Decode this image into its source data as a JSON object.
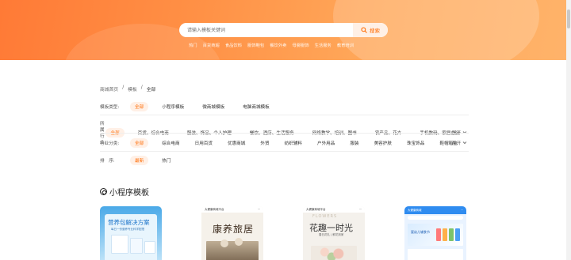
{
  "search": {
    "placeholder": "请输入模板关键词",
    "button_label": "搜索"
  },
  "hot_tags": [
    "热门",
    "百货商超",
    "食品饮料",
    "服饰鞋包",
    "餐饮外卖",
    "母婴服饰",
    "生活服务",
    "教育培训"
  ],
  "breadcrumb": {
    "home": "商城首页",
    "sep": "/",
    "templates": "模板",
    "current": "全部"
  },
  "filters": {
    "template_type": {
      "label": "模板类型:",
      "options": [
        "全部",
        "小程序模板",
        "微商城模板",
        "电脑商城模板"
      ],
      "selected": 0
    },
    "industry": {
      "label": "所属行业:",
      "options": [
        "全部",
        "百货、综合电商",
        "服装、饰品、个人护理",
        "餐饮、酒店、生活服务",
        "网络教学、培训、图书",
        "农产品、花卉",
        "手机数码、家居办公"
      ],
      "selected": 0,
      "expand": "展开"
    },
    "industry_class": {
      "label": "行业分类:",
      "options": [
        "全部",
        "综合电商",
        "日用百货",
        "优惠商城",
        "外贸",
        "纺织辅料",
        "户外用品",
        "服装",
        "美容护肤",
        "珠宝饰品",
        "鞋帽箱包"
      ],
      "selected": 0,
      "expand": "展开"
    },
    "sort": {
      "label": "排　序:",
      "options": [
        "最新",
        "热门"
      ],
      "selected": 0
    }
  },
  "section_title": "小程序模板",
  "cards": [
    {
      "title": "营养包解决方案",
      "subtitle": "每日一份营养专业科学配搭",
      "accent": "#ff6a00"
    },
    {
      "topbar": "大健康商城平台",
      "title": "康养旅居"
    },
    {
      "topbar": "大健康商城平台",
      "flowers": "FLOWERS",
      "title": "花趣一时光",
      "caption": "春日花礼 | 鲜花到家"
    },
    {
      "topbar": "大健康商城",
      "banner": "婴幼儿辅食节"
    }
  ],
  "colors": {
    "accent": "#ff6a00",
    "hero_start": "#ff7a36",
    "hero_end": "#ffb36a"
  }
}
